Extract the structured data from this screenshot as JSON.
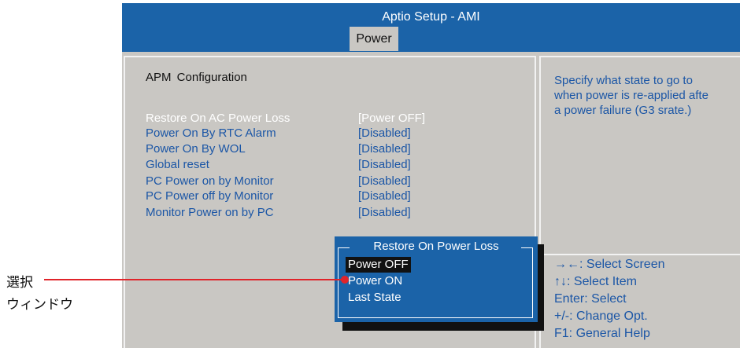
{
  "header": {
    "title": "Aptio Setup - AMI",
    "active_tab": "Power"
  },
  "main": {
    "section_title": "APM Configuration",
    "items": [
      {
        "label": "Restore On AC Power Loss",
        "value": "[Power OFF]",
        "selected": true
      },
      {
        "label": "Power On By RTC Alarm",
        "value": "[Disabled]"
      },
      {
        "label": "Power On By WOL",
        "value": "[Disabled]"
      },
      {
        "label": "Global reset",
        "value": "[Disabled]"
      },
      {
        "label": "PC Power on by Monitor",
        "value": "[Disabled]"
      },
      {
        "label": "PC Power off by Monitor",
        "value": "[Disabled]"
      },
      {
        "label": "Monitor Power on by PC",
        "value": "[Disabled]"
      }
    ]
  },
  "help": {
    "lines": [
      "Specify what state to go to",
      "when power is re-applied afte",
      "a power failure (G3 srate.)"
    ]
  },
  "keys": [
    "→←: Select Screen",
    "↑↓: Select Item",
    "Enter: Select",
    "+/-: Change Opt.",
    "F1: General Help"
  ],
  "popup": {
    "title": "Restore On Power Loss",
    "options": [
      "Power OFF",
      "Power ON",
      "Last State"
    ],
    "selected_option": "Power OFF"
  },
  "annotation": {
    "line1": "選択",
    "line2": "ウィンドウ"
  },
  "colors": {
    "header_blue": "#1b63a8",
    "panel_gray": "#c9c7c3",
    "text_blue": "#1b56a6",
    "annotation_red": "#e0242a"
  }
}
